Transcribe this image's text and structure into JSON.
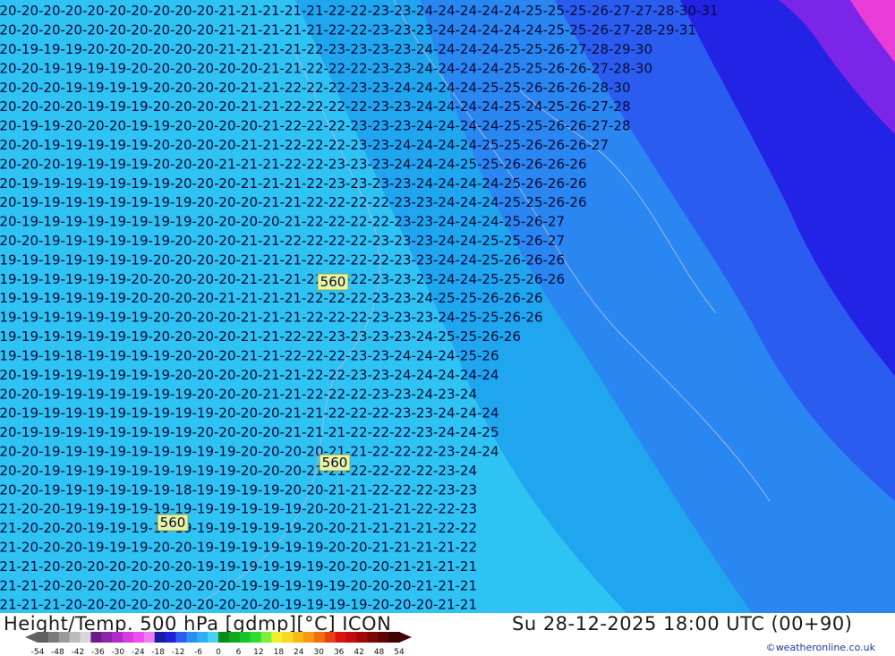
{
  "map": {
    "region_colors": {
      "light": "#2ec3f2",
      "mid": "#1fa6ee",
      "blue": "#2a5cf0",
      "deep": "#2323e6",
      "violet": "#7b25e8",
      "magenta": "#e83cd8"
    },
    "contour_color": "#9fb8de",
    "label_color": "#0a0a3a",
    "height_boxes": [
      "560",
      "560",
      "560"
    ],
    "temperature_rows": [
      "-20-20-20-20-20-20-20-20-20-20-21-21-21-21-21-22-22-23-23-24-24-24-24-24-25-25-25-26-27-27-28-30-31",
      "-20-20-20-20-20-20-20-20-20-20-21-21-21-21-21-22-22-23-23-23-24-24-24-24-24-25-25-26-27-28-29-31",
      "-20-19-19-19-20-20-20-20-20-20-21-21-21-21-22-23-23-23-23-24-24-24-24-25-25-26-27-28-29-30",
      "-20-20-19-19-19-19-20-20-20-20-20-20-21-21-22-22-22-23-23-24-24-24-24-25-25-26-26-27-28-30",
      "-20-20-20-19-19-19-19-20-20-20-20-21-21-22-22-22-23-23-24-24-24-24-25-25-26-26-26-28-30",
      "-20-20-20-20-19-19-19-20-20-20-20-21-21-22-22-22-22-23-23-24-24-24-24-25-24-25-26-27-28",
      "-20-19-19-20-20-20-19-19-20-20-20-20-21-22-22-22-23-23-23-24-24-24-24-25-25-26-26-27-28",
      "-20-20-19-19-19-19-19-20-20-20-20-21-21-22-22-22-23-23-24-24-24-24-25-25-26-26-26-27",
      "-20-20-20-19-19-19-19-20-20-20-21-21-21-22-22-23-23-23-24-24-24-25-25-26-26-26-26",
      "-20-19-19-19-19-19-19-19-20-20-20-21-21-21-22-23-23-23-23-24-24-24-24-25-26-26-26",
      "-20-19-19-19-19-19-19-19-19-20-20-20-21-21-22-22-22-22-23-23-24-24-24-25-25-26-26",
      "-20-19-19-19-19-19-19-19-19-20-20-20-20-21-22-22-22-22-23-23-24-24-24-25-26-27",
      "-20-20-19-19-19-19-19-19-20-20-20-21-21-22-22-22-22-23-23-23-24-24-25-25-26-27",
      "-19-19-19-19-19-19-19-20-20-20-20-21-21-21-22-22-22-22-23-23-24-24-25-26-26-26",
      "-19-19-19-19-19-19-20-20-20-20-20-21-21-21-22-22-22-23-23-23-24-24-25-25-26-26",
      "-19-19-19-19-19-19-20-20-20-20-21-21-21-21-22-22-22-23-23-24-25-25-26-26-26",
      "-19-19-19-19-19-19-19-20-20-20-20-21-21-21-22-22-22-23-23-23-24-25-25-26-26",
      "-19-19-19-19-19-19-19-20-20-20-20-21-21-22-22-23-23-23-23-24-25-25-26-26",
      "-19-19-19-18-19-19-19-19-20-20-20-21-21-22-22-22-23-23-24-24-24-25-26",
      "-20-19-19-19-19-19-19-19-20-20-20-20-21-21-22-22-23-23-24-24-24-24-24",
      "-20-20-19-19-19-19-19-19-19-20-20-20-21-21-22-22-22-23-23-24-23-24",
      "-20-19-19-19-19-19-19-19-19-19-20-20-20-21-21-22-22-22-23-23-24-24-24",
      "-20-19-19-19-19-19-19-19-19-20-20-20-20-21-21-21-22-22-22-23-24-24-25",
      "-20-20-19-19-19-19-19-19-19-19-19-20-20-20-20-21-21-22-22-22-23-24-24",
      "-20-20-19-19-19-19-19-19-19-19-19-20-20-20-21-21-22-22-22-22-23-24",
      "-20-20-19-19-19-19-19-19-18-19-19-19-19-20-20-21-21-22-22-22-23-23",
      "-21-20-20-19-19-19-19-19-19-19-19-19-19-19-20-20-21-21-21-22-22-23",
      "-21-20-20-20-19-19-19-19-19-19-19-19-19-19-20-20-21-21-21-21-22-22",
      "-21-20-20-20-19-19-19-20-20-19-19-19-19-19-19-20-20-21-21-21-21-22",
      "-21-21-20-20-20-20-20-20-20-19-19-19-19-19-19-20-20-20-21-21-21-21",
      "-21-21-20-20-20-20-20-20-20-20-20-19-19-19-19-19-20-20-20-21-21-21",
      "-21-21-21-20-20-20-20-20-20-20-20-20-20-19-19-19-19-20-20-20-21-21"
    ]
  },
  "footer": {
    "title_left": "Height/Temp. 500 hPa [gdmp][°C] ICON",
    "title_right": "Su 28-12-2025 18:00 UTC (00+90)",
    "credit": "©weatheronline.co.uk"
  },
  "legend": {
    "ticks": [
      "-54",
      "-48",
      "-42",
      "-36",
      "-30",
      "-24",
      "-18",
      "-12",
      "-6",
      "0",
      "6",
      "12",
      "18",
      "24",
      "30",
      "36",
      "42",
      "48",
      "54"
    ],
    "colors": [
      "#606060",
      "#7a7a7a",
      "#9a9a9a",
      "#bcbcbc",
      "#d8d8d8",
      "#6a1a8a",
      "#8e24aa",
      "#b02cc8",
      "#d63ae0",
      "#ee4ef0",
      "#f07cf0",
      "#1a1aa0",
      "#2020d8",
      "#2a5cf0",
      "#2e8ef0",
      "#2eb0f2",
      "#4ad0f4",
      "#0a8a1a",
      "#10a820",
      "#18c428",
      "#2ade30",
      "#7cf038",
      "#f0f030",
      "#f8d820",
      "#f8b818",
      "#f89810",
      "#f07010",
      "#e84010",
      "#e01010",
      "#c00c0c",
      "#a00808",
      "#800606",
      "#600404",
      "#400202"
    ]
  }
}
